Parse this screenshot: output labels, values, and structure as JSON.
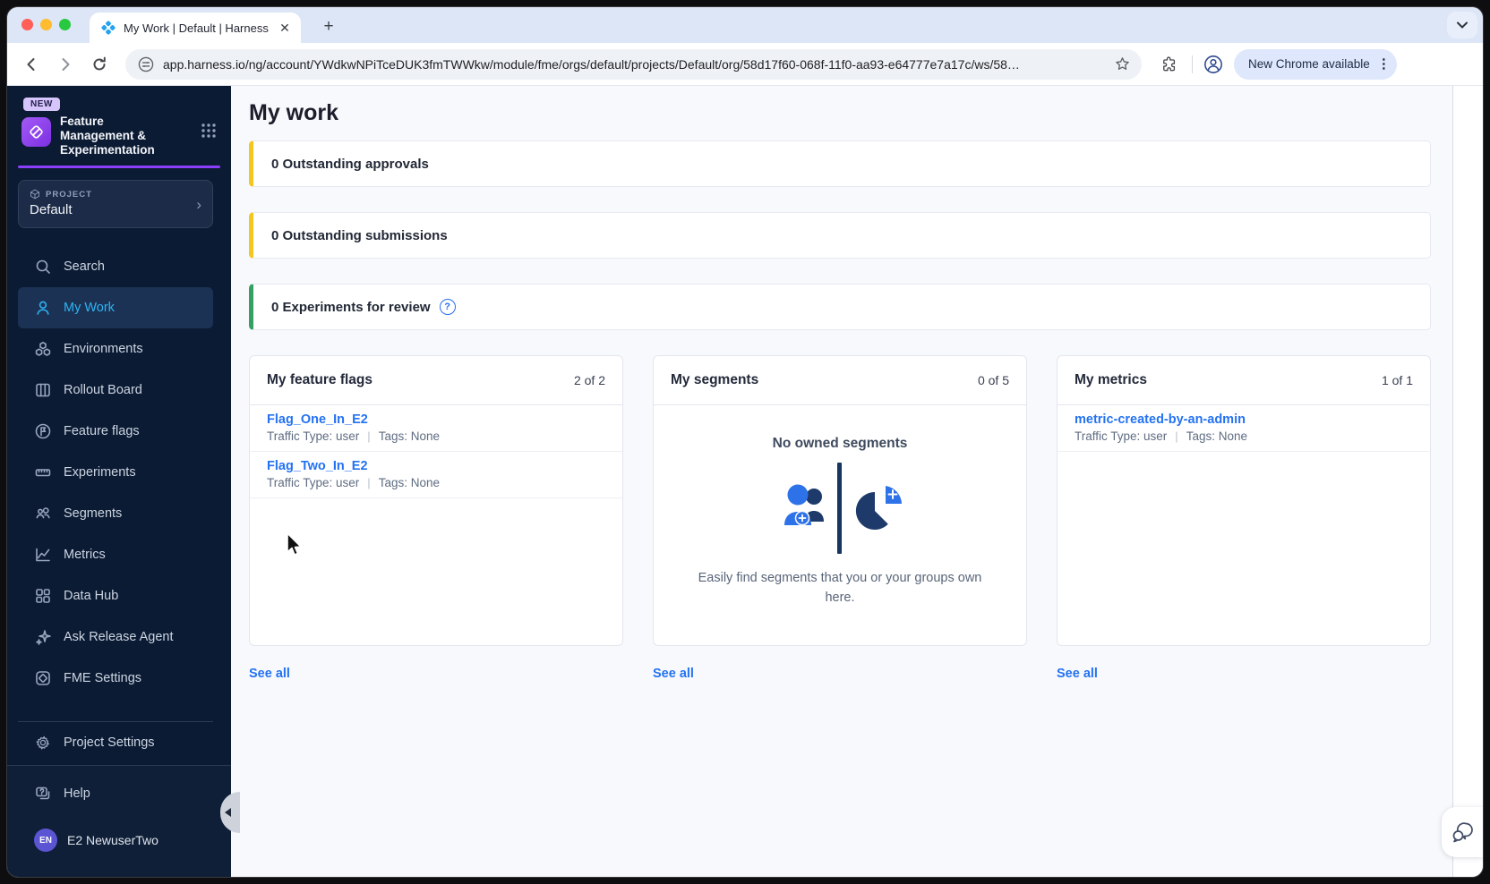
{
  "browser": {
    "tab_title": "My Work | Default | Harness",
    "url": "app.harness.io/ng/account/YWdkwNPiTceDUK3fmTWWkw/module/fme/orgs/default/projects/Default/org/58d17f60-068f-11f0-aa93-e64777e7a17c/ws/58…",
    "update_button": "New Chrome available"
  },
  "sidebar": {
    "new_badge": "NEW",
    "module_title": "Feature Management & Experimentation",
    "project": {
      "label": "PROJECT",
      "name": "Default"
    },
    "items": [
      {
        "label": "Search"
      },
      {
        "label": "My Work"
      },
      {
        "label": "Environments"
      },
      {
        "label": "Rollout Board"
      },
      {
        "label": "Feature flags"
      },
      {
        "label": "Experiments"
      },
      {
        "label": "Segments"
      },
      {
        "label": "Metrics"
      },
      {
        "label": "Data Hub"
      },
      {
        "label": "Ask Release Agent"
      },
      {
        "label": "FME Settings"
      }
    ],
    "project_settings_label": "Project Settings",
    "help_label": "Help",
    "user": {
      "initials": "EN",
      "name": "E2 NewuserTwo"
    }
  },
  "main": {
    "title": "My work",
    "banners": [
      {
        "text": "0 Outstanding approvals",
        "accent": "#F5C620"
      },
      {
        "text": "0 Outstanding submissions",
        "accent": "#F5C620"
      },
      {
        "text": "0 Experiments for review",
        "accent": "#36A064"
      }
    ],
    "cards": [
      {
        "title": "My feature flags",
        "count": "2 of 2",
        "items": [
          {
            "name": "Flag_One_In_E2",
            "traffic": "Traffic Type: user",
            "tags": "Tags: None"
          },
          {
            "name": "Flag_Two_In_E2",
            "traffic": "Traffic Type: user",
            "tags": "Tags: None"
          }
        ],
        "see_all": "See all"
      },
      {
        "title": "My segments",
        "count": "0 of 5",
        "empty_heading": "No owned segments",
        "empty_body": "Easily find segments that you or your groups own here.",
        "see_all": "See all"
      },
      {
        "title": "My metrics",
        "count": "1 of 1",
        "items": [
          {
            "name": "metric-created-by-an-admin",
            "traffic": "Traffic Type: user",
            "tags": "Tags: None"
          }
        ],
        "see_all": "See all"
      }
    ]
  },
  "colors": {
    "sidebar_bg": "#0B1B33",
    "sidebar_active_text": "#2DB3F2",
    "module_accent": "#8B3EFC",
    "link_blue": "#2472F2",
    "banner_yellow": "#F5C620",
    "banner_green": "#36A064",
    "illustration_blue": "#2D72E8",
    "illustration_navy": "#1D3A6B"
  }
}
